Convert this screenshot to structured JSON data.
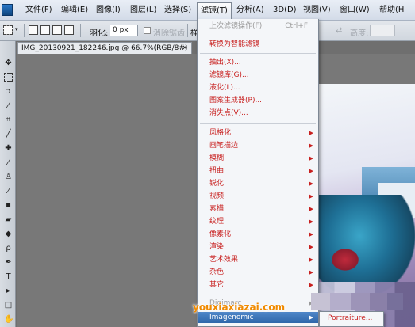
{
  "menubar": {
    "items": [
      {
        "label": "文件(F)"
      },
      {
        "label": "编辑(E)"
      },
      {
        "label": "图像(I)"
      },
      {
        "label": "图层(L)"
      },
      {
        "label": "选择(S)"
      },
      {
        "label": "滤镜(T)"
      },
      {
        "label": "分析(A)"
      },
      {
        "label": "3D(D)"
      },
      {
        "label": "视图(V)"
      },
      {
        "label": "窗口(W)"
      },
      {
        "label": "帮助(H"
      }
    ]
  },
  "options": {
    "feather_label": "羽化:",
    "feather_value": "0 px",
    "antialias_label": "消除锯齿",
    "partial_label": "样",
    "height_label": "高度:"
  },
  "document": {
    "tab_title": "IMG_20130921_182246.jpg @ 66.7%(RGB/8#)",
    "close": "×"
  },
  "filter_menu": {
    "last_filter": {
      "label": "上次滤镜操作(F)",
      "shortcut": "Ctrl+F"
    },
    "smart": "转换为智能滤镜",
    "group1": [
      "抽出(X)...",
      "滤镜库(G)...",
      "液化(L)...",
      "图案生成器(P)...",
      "消失点(V)..."
    ],
    "group2": [
      "风格化",
      "画笔描边",
      "模糊",
      "扭曲",
      "锐化",
      "视频",
      "素描",
      "纹理",
      "像素化",
      "渲染",
      "艺术效果",
      "杂色",
      "其它"
    ],
    "plugin_disabled": "Digimarc",
    "plugin_selected": "Imagenomic"
  },
  "submenu": {
    "item": "Portraiture..."
  },
  "watermark": "youxiaxiazai.com"
}
